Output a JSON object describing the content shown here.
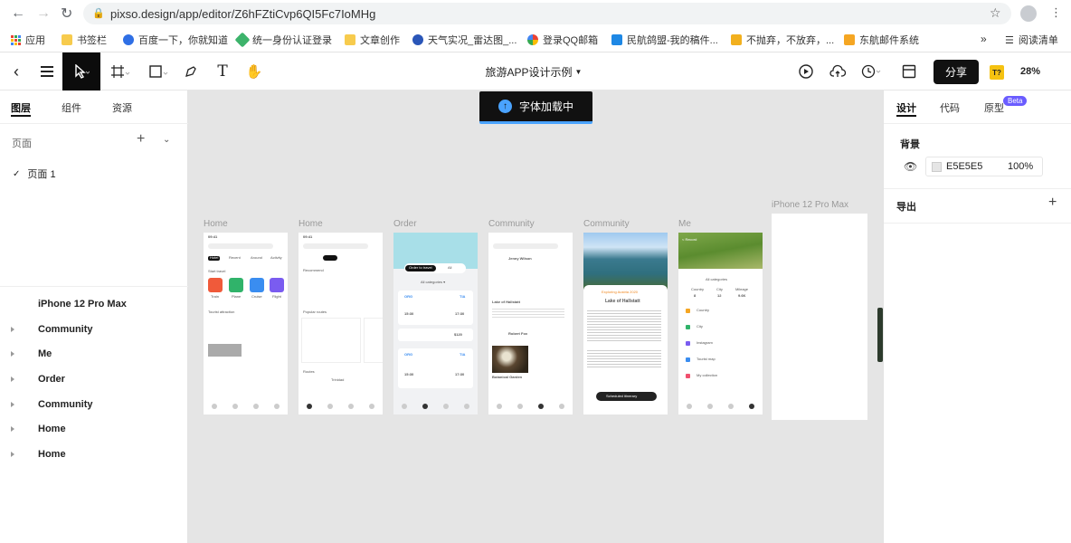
{
  "browser": {
    "url": "pixso.design/app/editor/Z6hFZtiCvp6QI5Fc7IoMHg",
    "bookmarks": [
      "应用",
      "书签栏",
      "百度一下，你就知道",
      "统一身份认证登录",
      "文章创作",
      "天气实况_雷达图_...",
      "登录QQ邮箱",
      "民航鸽盟-我的稿件...",
      "不抛弃，不放弃，...",
      "东航邮件系统"
    ],
    "reading_list": "阅读清单",
    "more": "»"
  },
  "toolbar": {
    "doc_title": "旅游APP设计示例",
    "share": "分享",
    "zoom": "28%",
    "avatar_text": "T?"
  },
  "left_panel": {
    "tabs": [
      "图层",
      "组件",
      "资源"
    ],
    "pages_label": "页面",
    "page1": "页面 1",
    "layers": [
      "iPhone 12 Pro Max",
      "Community",
      "Me",
      "Order",
      "Community",
      "Home",
      "Home"
    ]
  },
  "right_panel": {
    "tabs": [
      "设计",
      "代码",
      "原型"
    ],
    "beta": "Beta",
    "bg_label": "背景",
    "bg_hex": "E5E5E5",
    "bg_opacity": "100%",
    "export_label": "导出"
  },
  "toast": "字体加载中",
  "help": "?",
  "frames": {
    "labels": [
      "Home",
      "Home",
      "Order",
      "Community",
      "Community",
      "Me",
      "iPhone 12 Pro Max"
    ],
    "home1": {
      "time": "09:41",
      "tabs": [
        "Hotel",
        "Recent",
        "Around",
        "Activity"
      ],
      "start": "Start travel",
      "cats": [
        "Train",
        "Plane",
        "Cruise",
        "Flight"
      ],
      "tourist": "Tourist attraction"
    },
    "home2": {
      "time": "09:41",
      "recommend": "Recommend",
      "popular": "Popular routes",
      "routes": "Routes",
      "trinidad": "Trinidad"
    },
    "order": {
      "order_travel": "Order to travel",
      "all": "All",
      "all_cat": "All categories ▾",
      "org": "ORG",
      "tia": "TIA",
      "t1": "15:30",
      "t2": "17:30",
      "price": "$120"
    },
    "comm1": {
      "name": "Jenny Wilson",
      "place": "Lake of Hallstatt",
      "person": "Robert Fox",
      "garden": "Botanical Garden"
    },
    "comm2": {
      "tag": "Exploring Austria 2020",
      "title": "Lake of Hallstatt",
      "btn": "Scheduled itinerary"
    },
    "me": {
      "record": "< Record",
      "allcat": "All categories",
      "stats": [
        "Country",
        "City",
        "Mileage"
      ],
      "vals": [
        "8",
        "12",
        "9.6K"
      ],
      "items": [
        "Country",
        "City",
        "Instagram",
        "Tourist map",
        "My collection"
      ]
    }
  },
  "colors": {
    "accent": "#0c0c0c",
    "beta": "#6a5cff",
    "toast_icon": "#4aa3ff",
    "share_bg": "#111111",
    "avatar": "#f5c211"
  }
}
